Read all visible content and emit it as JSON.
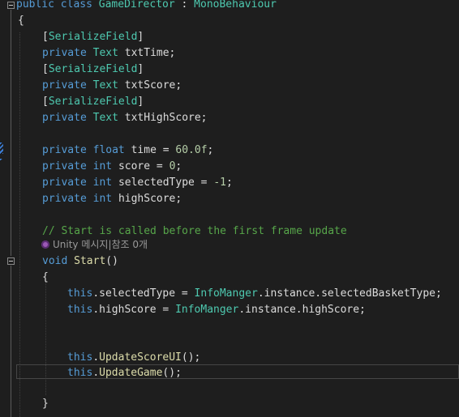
{
  "editor": {
    "class_line": {
      "kw1": "public",
      "kw2": "class",
      "name": "GameDirector",
      "sep": " : ",
      "base": "MonoBehaviour"
    },
    "open_brace": "{",
    "fields": [
      {
        "attribute": "SerializeField",
        "modifier": "private",
        "type": "Text",
        "name": "txtTime;"
      },
      {
        "attribute": "SerializeField",
        "modifier": "private",
        "type": "Text",
        "name": "txtScore;"
      },
      {
        "attribute": "SerializeField",
        "modifier": "private",
        "type": "Text",
        "name": "txtHighScore;"
      }
    ],
    "vars": [
      {
        "modifier": "private",
        "type": "float",
        "rest": "time = ",
        "value": "60.0f",
        "end": ";"
      },
      {
        "modifier": "private",
        "type": "int",
        "rest": "score = ",
        "value": "0",
        "end": ";"
      },
      {
        "modifier": "private",
        "type": "int",
        "rest": "selectedType = ",
        "value": "-1",
        "end": ";"
      },
      {
        "modifier": "private",
        "type": "int",
        "rest": "highScore;",
        "value": "",
        "end": ""
      }
    ],
    "comment": "// Start is called before the first frame update",
    "codelens": "Unity 메시지|참조 0개",
    "method": {
      "kw": "void",
      "name": "Start",
      "params": "()"
    },
    "method_open": "{",
    "body": [
      {
        "this": "this",
        "a": ".selectedType = ",
        "cls": "InfoManger",
        "b": ".instance.selectedBasketType;"
      },
      {
        "this": "this",
        "a": ".highScore = ",
        "cls": "InfoManger",
        "b": ".instance.highScore;"
      }
    ],
    "calls": [
      {
        "this": "this",
        "dot": ".",
        "method": "UpdateScoreUI",
        "end": "();"
      },
      {
        "this": "this",
        "dot": ".",
        "method": "UpdateGame",
        "end": "();"
      }
    ],
    "method_close": "}",
    "bracket_open": "[",
    "bracket_close": "]"
  }
}
